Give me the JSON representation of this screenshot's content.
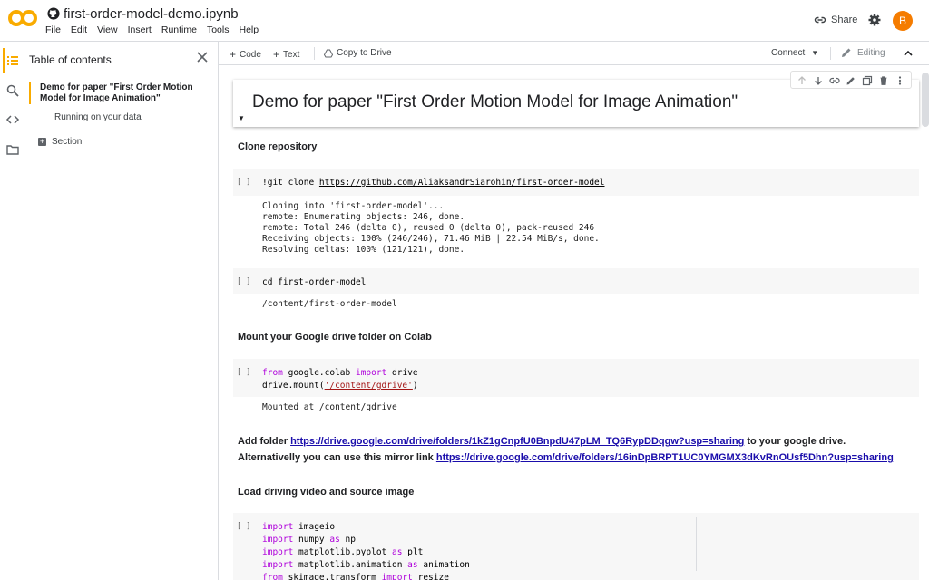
{
  "header": {
    "doc_title": "first-order-model-demo.ipynb",
    "menu": [
      "File",
      "Edit",
      "View",
      "Insert",
      "Runtime",
      "Tools",
      "Help"
    ],
    "share_label": "Share",
    "avatar_letter": "B",
    "logo_color": "#f9ab00",
    "avatar_color": "#f57c00"
  },
  "sidebar": {
    "title": "Table of contents",
    "items": [
      {
        "label": "Demo for paper \"First Order Motion Model for Image Animation\""
      },
      {
        "label": "Running on your data"
      },
      {
        "label": "Section"
      }
    ]
  },
  "toolbar": {
    "code_label": "Code",
    "text_label": "Text",
    "copy_drive_label": "Copy to Drive",
    "connect_label": "Connect",
    "editing_label": "Editing"
  },
  "notebook": {
    "heading": "Demo for paper \"First Order Motion Model for Image Animation\"",
    "section_clone": "Clone repository",
    "cell1": {
      "run": "[ ]",
      "cmd": "!git clone ",
      "url": "https://github.com/AliaksandrSiarohin/first-order-model",
      "output": "Cloning into 'first-order-model'...\nremote: Enumerating objects: 246, done.\nremote: Total 246 (delta 0), reused 0 (delta 0), pack-reused 246\nReceiving objects: 100% (246/246), 71.46 MiB | 22.54 MiB/s, done.\nResolving deltas: 100% (121/121), done."
    },
    "cell2": {
      "run": "[ ]",
      "cmd": "cd first-order-model",
      "output": "/content/first-order-model"
    },
    "section_mount": "Mount your Google drive folder on Colab",
    "cell3": {
      "run": "[ ]",
      "line1_kw1": "from",
      "line1_mid": " google.colab ",
      "line1_kw2": "import",
      "line1_end": " drive",
      "line2_start": "drive.mount(",
      "line2_str": "'/content/gdrive'",
      "line2_end": ")",
      "output": "Mounted at /content/gdrive"
    },
    "add_folder": {
      "prefix": "Add folder ",
      "link": "https://drive.google.com/drive/folders/1kZ1gCnpfU0BnpdU47pLM_TQ6RypDDqgw?usp=sharing",
      "suffix": " to your google drive.",
      "line2_prefix": "Alternativelly you can use this mirror link ",
      "line2_link": "https://drive.google.com/drive/folders/16inDpBRPT1UC0YMGMX3dKvRnOUsf5Dhn?usp=sharing"
    },
    "section_load": "Load driving video and source image",
    "cell4": {
      "run": "[ ]",
      "lines": [
        {
          "kw": "import",
          "rest": " imageio"
        },
        {
          "kw": "import",
          "rest": " numpy ",
          "kw2": "as",
          "rest2": " np"
        },
        {
          "kw": "import",
          "rest": " matplotlib.pyplot ",
          "kw2": "as",
          "rest2": " plt"
        },
        {
          "kw": "import",
          "rest": " matplotlib.animation ",
          "kw2": "as",
          "rest2": " animation"
        },
        {
          "kw": "from",
          "rest": " skimage.transform ",
          "kw2": "import",
          "rest2": " resize"
        }
      ]
    }
  }
}
